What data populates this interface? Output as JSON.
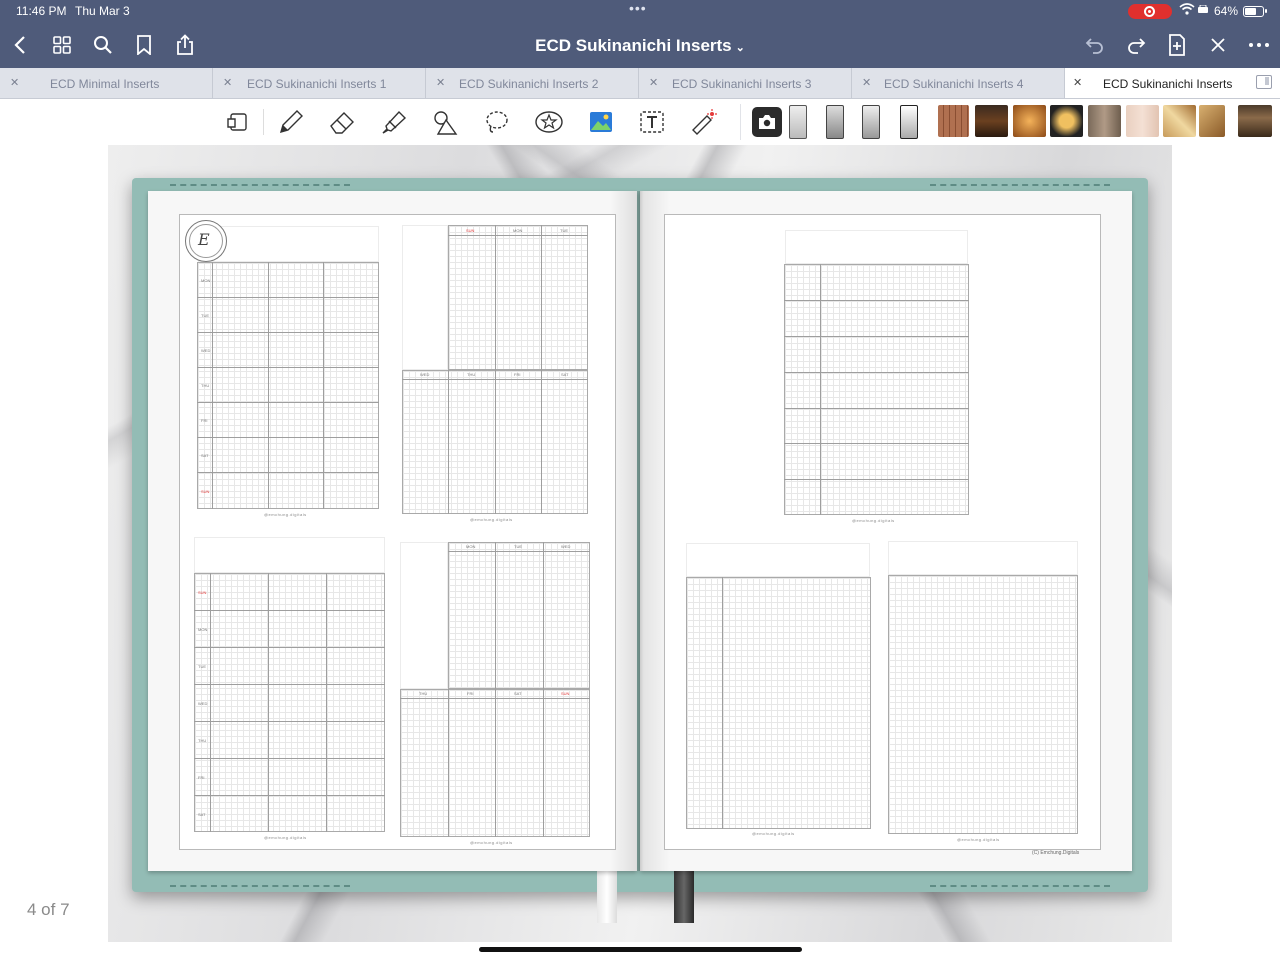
{
  "status_bar": {
    "time": "11:46 PM",
    "date": "Thu Mar 3",
    "dots": "•••",
    "battery": "64%"
  },
  "nav": {
    "title": "ECD Sukinanichi Inserts"
  },
  "tabs": [
    {
      "label": "ECD Minimal Inserts"
    },
    {
      "label": "ECD Sukinanichi Inserts 1"
    },
    {
      "label": "ECD Sukinanichi Inserts 2"
    },
    {
      "label": "ECD Sukinanichi Inserts 3"
    },
    {
      "label": "ECD Sukinanichi Inserts 4"
    },
    {
      "label": "ECD Sukinanichi Inserts",
      "active": true
    }
  ],
  "tools": [
    "lasso-select",
    "pen",
    "eraser",
    "highlighter",
    "shapes",
    "lasso",
    "elements",
    "image",
    "text",
    "laser-pointer",
    "camera"
  ],
  "colors": {
    "topbar": "#4f5b7a",
    "cover": "#93bcb5",
    "accent_red": "#e53b3b"
  },
  "planner": {
    "left_a_days": [
      "MON",
      "TUE",
      "WED",
      "THU",
      "FRI",
      "SAT",
      "SUN"
    ],
    "left_b_top_days": [
      "SUN",
      "MON",
      "TUE"
    ],
    "left_b_bottom_days": [
      "WED",
      "THU",
      "FRI",
      "SAT"
    ],
    "left_c_days": [
      "SUN",
      "MON",
      "TUE",
      "WED",
      "THU",
      "FRI",
      "SAT"
    ],
    "left_d_top_days": [
      "MON",
      "TUE",
      "WED"
    ],
    "left_d_bottom_days": [
      "THU",
      "FRI",
      "SAT",
      "SUN"
    ],
    "footer": "@emchung.digitals",
    "copyright": "(C) Emchung.Digitals"
  },
  "page_indicator": "4 of 7"
}
